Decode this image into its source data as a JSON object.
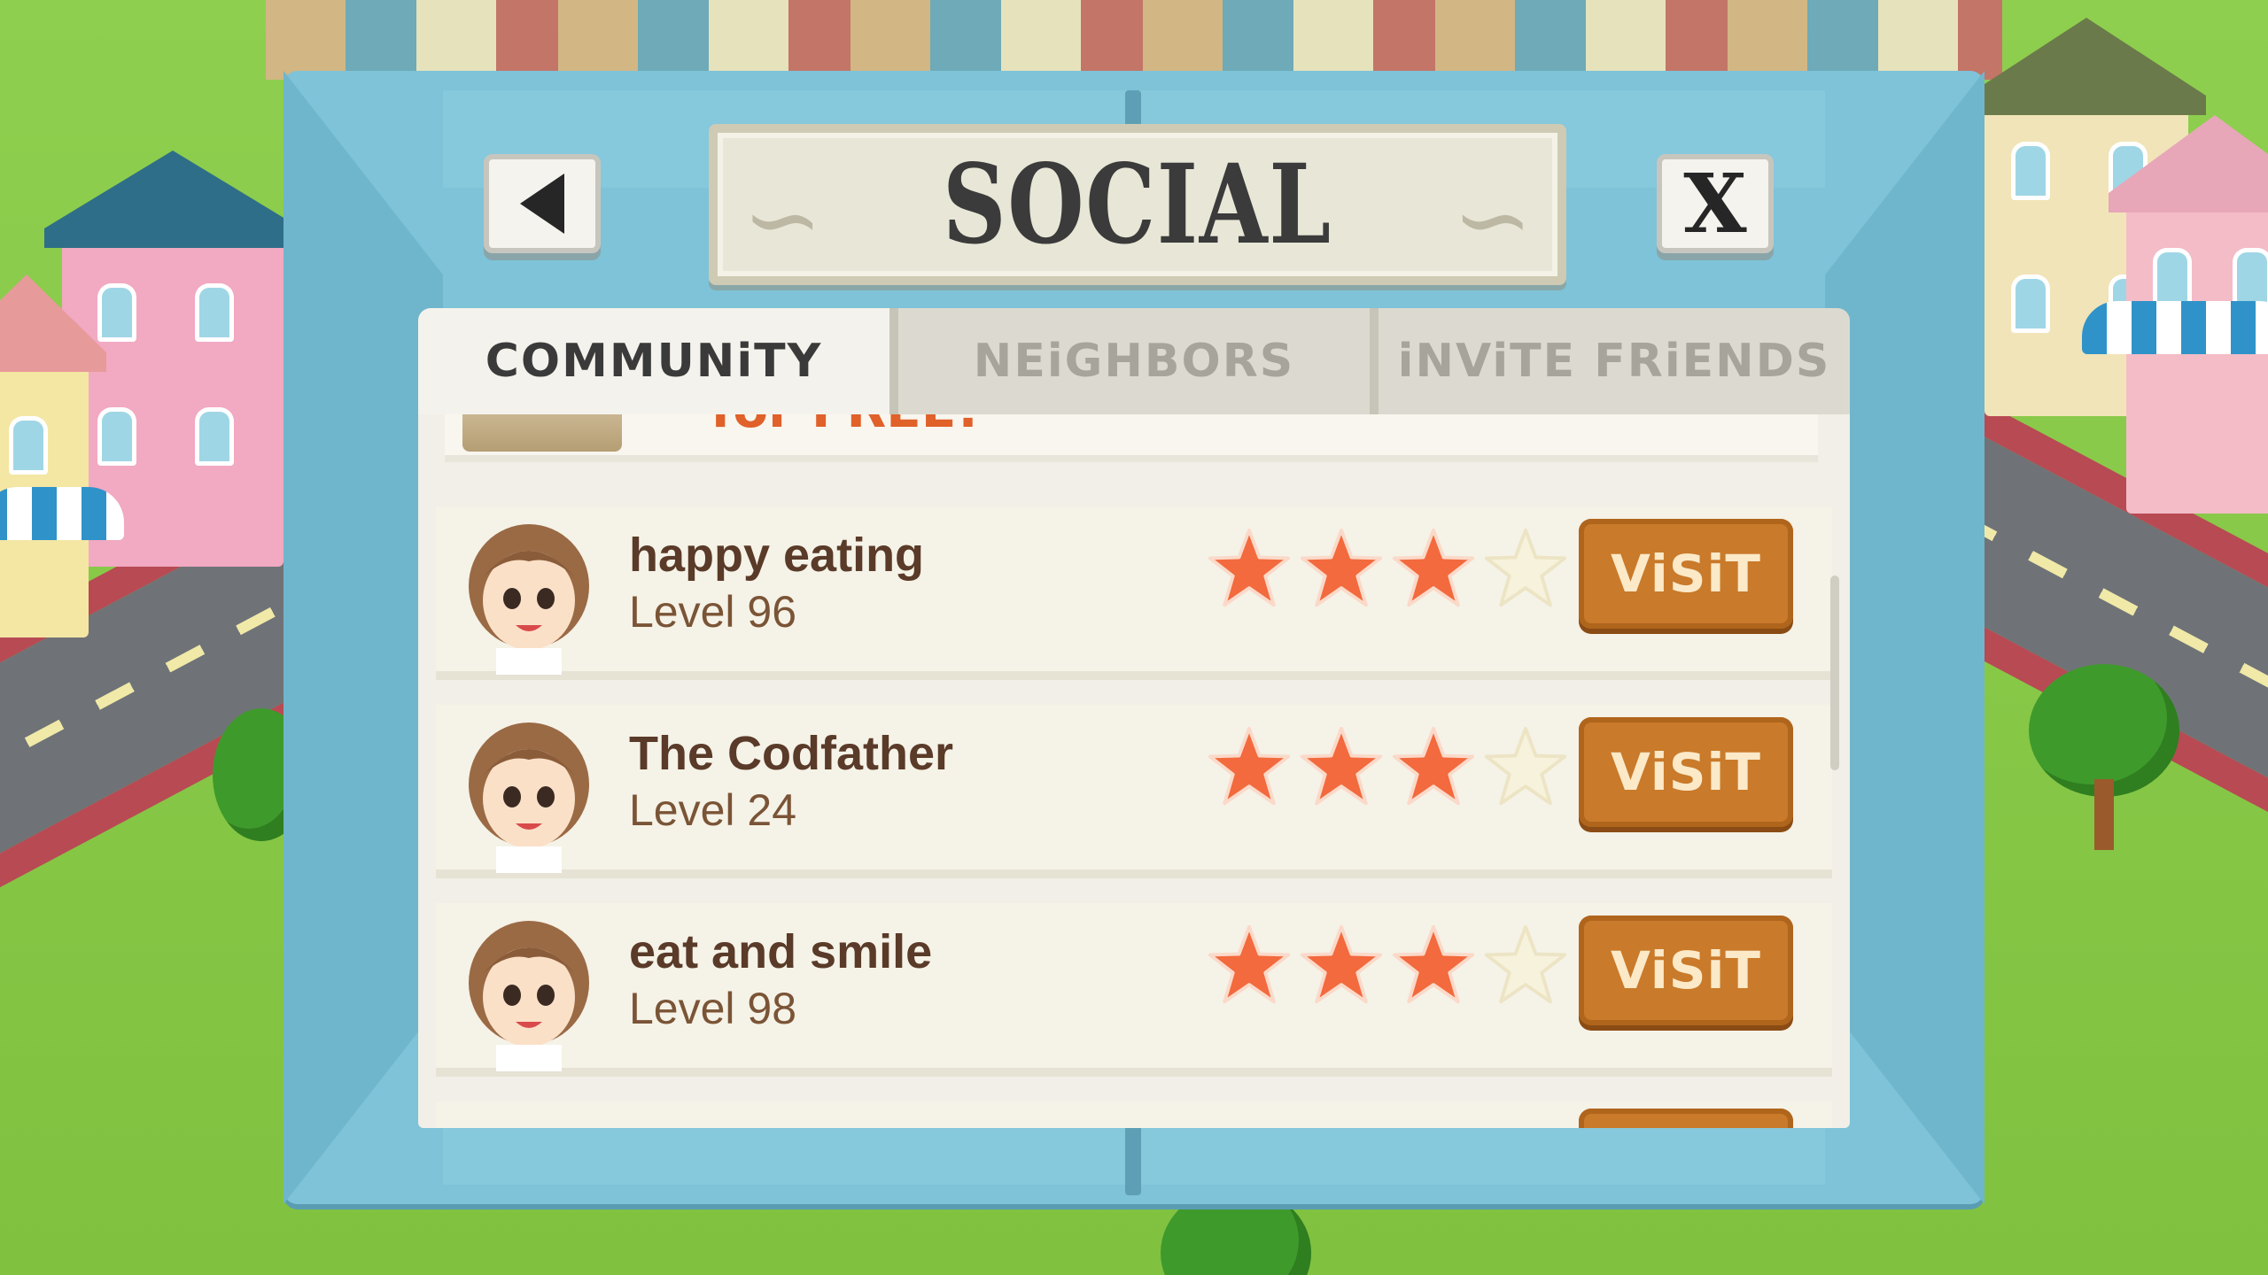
{
  "title": "SOCIAL",
  "nav": {
    "back_icon": "back-arrow-icon",
    "close_label": "X"
  },
  "tabs": [
    {
      "label": "COMMUNiTY",
      "active": true
    },
    {
      "label": "NEiGHBORS",
      "active": false
    },
    {
      "label": "iNViTE FRiENDS",
      "active": false
    }
  ],
  "promo": {
    "text": "for FREE!"
  },
  "players": [
    {
      "name": "happy eating",
      "level": "Level 96",
      "rating": 3,
      "max_rating": 4,
      "visit_label": "ViSiT"
    },
    {
      "name": "The Codfather",
      "level": "Level 24",
      "rating": 3,
      "max_rating": 4,
      "visit_label": "ViSiT"
    },
    {
      "name": "eat and smile",
      "level": "Level 98",
      "rating": 3,
      "max_rating": 4,
      "visit_label": "ViSiT"
    }
  ],
  "colors": {
    "star_on": "#f26a3d",
    "star_off": "#f7f2dc",
    "visit_button": "#c97a2a",
    "frame": "#7ec3d8"
  }
}
